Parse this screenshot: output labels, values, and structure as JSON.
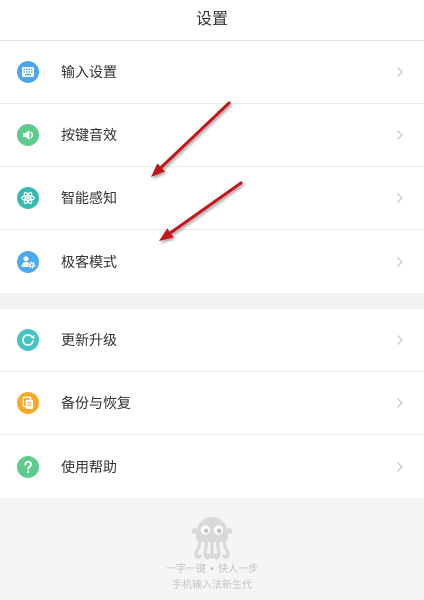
{
  "header": {
    "title": "设置"
  },
  "group_1": {
    "items": [
      {
        "label": "输入设置",
        "icon": "keyboard-icon",
        "color": "#4da5ef"
      },
      {
        "label": "按键音效",
        "icon": "speaker-icon",
        "color": "#5ccb8c"
      },
      {
        "label": "智能感知",
        "icon": "atom-icon",
        "color": "#34bcb4"
      },
      {
        "label": "极客模式",
        "icon": "geek-mode-icon",
        "color": "#4aa9f0"
      }
    ]
  },
  "group_2": {
    "items": [
      {
        "label": "更新升级",
        "icon": "refresh-icon",
        "color": "#42c4c2"
      },
      {
        "label": "备份与恢复",
        "icon": "backup-icon",
        "color": "#f8a825"
      },
      {
        "label": "使用帮助",
        "icon": "help-icon",
        "color": "#5ccb8c"
      }
    ]
  },
  "row_trailing_icon": "chevron-right-icon",
  "footer": {
    "logo": "octopus-logo",
    "slogan": "一字一键 • 快人一步",
    "tagline": "手机输入法新生代"
  },
  "annotations": {
    "icon": "arrow-annotation",
    "color": "#c3161c"
  },
  "colors": {
    "text": "#333333",
    "divider": "#ebebeb",
    "section_band": "#f2f2f2",
    "footer_background": "#f5f5f5",
    "footer_text": "#c4c4c4",
    "chevron": "#c9c9c9"
  }
}
